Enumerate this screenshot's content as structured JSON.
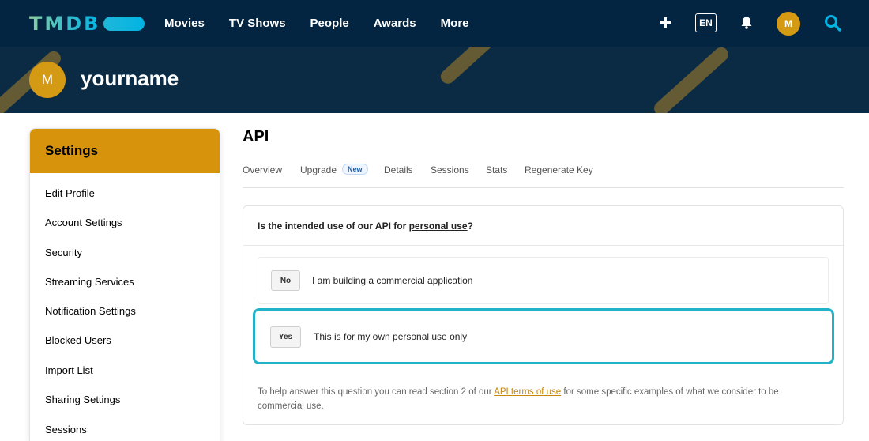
{
  "brand": {
    "logo": "TMDB"
  },
  "nav": {
    "items": [
      "Movies",
      "TV Shows",
      "People",
      "Awards",
      "More"
    ],
    "lang": "EN",
    "user_initial": "M"
  },
  "profile": {
    "initial": "M",
    "username": "yourname"
  },
  "sidebar": {
    "title": "Settings",
    "items": [
      "Edit Profile",
      "Account Settings",
      "Security",
      "Streaming Services",
      "Notification Settings",
      "Blocked Users",
      "Import List",
      "Sharing Settings",
      "Sessions"
    ]
  },
  "main": {
    "heading": "API",
    "tabs": [
      "Overview",
      "Upgrade",
      "Details",
      "Sessions",
      "Stats",
      "Regenerate Key"
    ],
    "new_badge": "New",
    "question_prefix": "Is the intended use of our API for ",
    "question_link": "personal use",
    "question_suffix": "?",
    "options": [
      {
        "button": "No",
        "text": "I am building a commercial application"
      },
      {
        "button": "Yes",
        "text": "This is for my own personal use only"
      }
    ],
    "help_prefix": "To help answer this question you can read section 2 of our ",
    "help_link": "API terms of use",
    "help_suffix": " for some specific examples of what we consider to be commercial use."
  },
  "colors": {
    "nav_bg": "#032541",
    "accent_gold": "#d7930b",
    "selected_border": "#21b3c9",
    "link": "#c7860a"
  }
}
